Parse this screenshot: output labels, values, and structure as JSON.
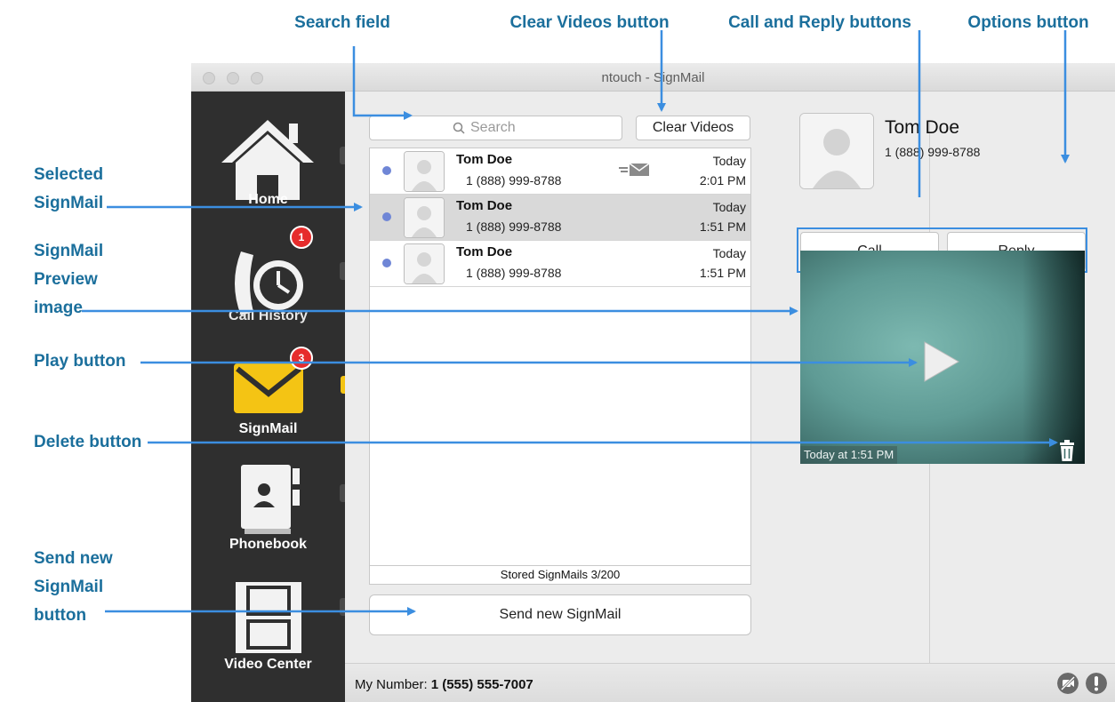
{
  "callouts": {
    "search_field": "Search field",
    "clear_videos_button": "Clear Videos button",
    "call_reply_buttons": "Call and Reply buttons",
    "options_button": "Options button",
    "selected_signmail": "Selected SignMail",
    "preview_image": "SignMail Preview image",
    "play_button": "Play button",
    "delete_button": "Delete button",
    "send_new_button": "Send new SignMail button"
  },
  "window": {
    "title": "ntouch - SignMail"
  },
  "sidebar": {
    "items": [
      {
        "label": "Home",
        "icon": "house-icon"
      },
      {
        "label": "Call History",
        "icon": "phone-clock-icon",
        "badge": "1"
      },
      {
        "label": "SignMail",
        "icon": "envelope-icon",
        "badge": "3",
        "active": true
      },
      {
        "label": "Phonebook",
        "icon": "address-book-icon"
      },
      {
        "label": "Video Center",
        "icon": "film-strip-icon"
      }
    ]
  },
  "search": {
    "placeholder": "Search"
  },
  "toolbar": {
    "clear_videos": "Clear Videos"
  },
  "signmails": [
    {
      "name": "Tom Doe",
      "number": "1 (888) 999-8788",
      "day": "Today",
      "time": "2:01 PM",
      "unread": true,
      "selected": false
    },
    {
      "name": "Tom Doe",
      "number": "1 (888) 999-8788",
      "day": "Today",
      "time": "1:51 PM",
      "unread": true,
      "selected": true
    },
    {
      "name": "Tom Doe",
      "number": "1 (888) 999-8788",
      "day": "Today",
      "time": "1:51 PM",
      "unread": true,
      "selected": false
    }
  ],
  "stored": "Stored SignMails 3/200",
  "send_new": "Send new SignMail",
  "detail": {
    "name": "Tom Doe",
    "number": "1 (888) 999-8788",
    "options_label": "+",
    "call_label": "Call",
    "reply_label": "Reply",
    "video_timestamp": "Today at 1:51 PM"
  },
  "footer": {
    "my_number_label": "My Number:",
    "my_number": "1 (555) 555-7007"
  },
  "colors": {
    "callout": "#1b6f9c",
    "arrow": "#3b8ee0",
    "unread_dot": "#6f86d6",
    "badge": "#e62c2c",
    "signmail_yellow": "#f4c414"
  }
}
